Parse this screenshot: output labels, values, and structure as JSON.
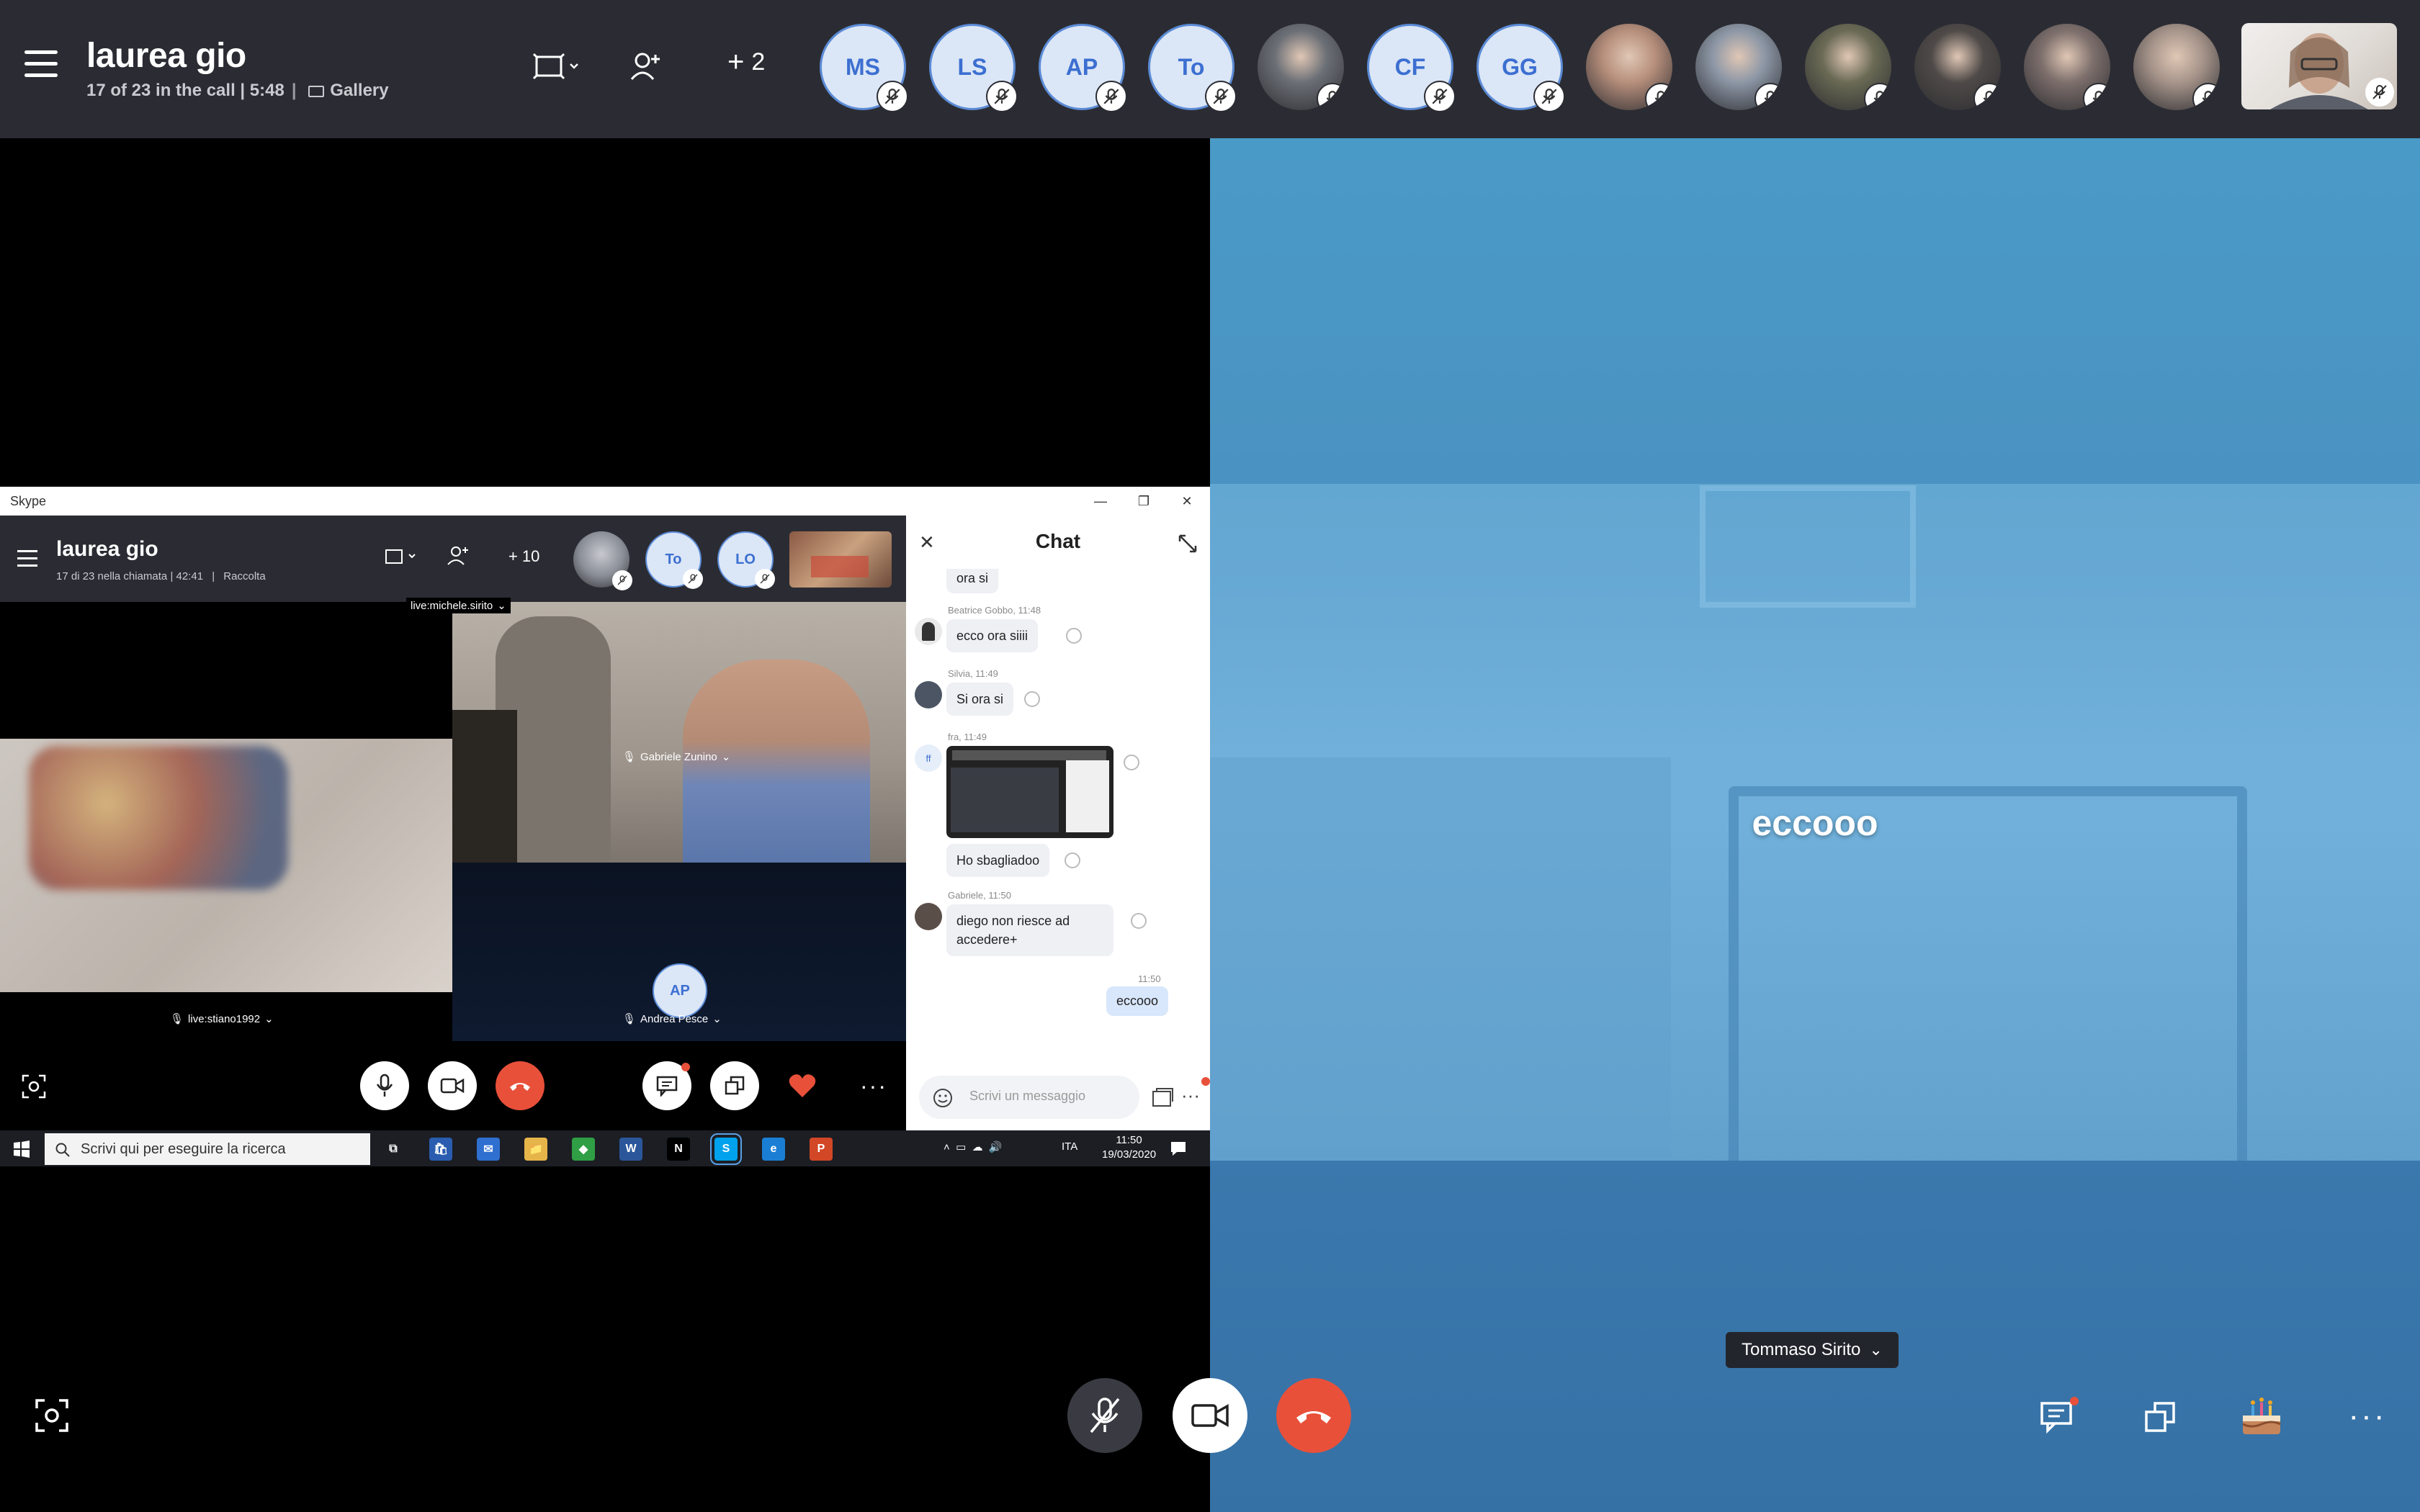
{
  "call": {
    "title": "laurea gio",
    "status": "17 of 23 in the call | 5:48",
    "sep": "|",
    "view": "Gallery",
    "more_count": "2",
    "participants": [
      {
        "kind": "initials",
        "initials": "MS"
      },
      {
        "kind": "initials",
        "initials": "LS"
      },
      {
        "kind": "initials",
        "initials": "AP"
      },
      {
        "kind": "initials",
        "initials": "To"
      },
      {
        "kind": "photo",
        "tone": "#6b6f76"
      },
      {
        "kind": "initials",
        "initials": "CF"
      },
      {
        "kind": "initials",
        "initials": "GG"
      },
      {
        "kind": "photo",
        "tone": "#b78f7c"
      },
      {
        "kind": "photo",
        "tone": "#8d97a6"
      },
      {
        "kind": "photo",
        "tone": "#6a6a55"
      },
      {
        "kind": "photo",
        "tone": "#4f4a48"
      },
      {
        "kind": "photo",
        "tone": "#7d6f6c"
      },
      {
        "kind": "photo",
        "tone": "#a7958b"
      }
    ]
  },
  "remote": {
    "caption": "eccooo",
    "name": "Tommaso Sirito"
  },
  "shared_screen": {
    "window_title": "Skype",
    "title": "laurea gio",
    "status": "17 di 23 nella chiamata | 42:41",
    "sep": "|",
    "view": "Raccolta",
    "more_count": "10",
    "participants": [
      {
        "kind": "photo",
        "tone": "#8a8e96"
      },
      {
        "kind": "initials",
        "initials": "To"
      },
      {
        "kind": "initials",
        "initials": "LO"
      },
      {
        "kind": "photo",
        "tone": "#9b6a55"
      }
    ],
    "tiles": {
      "top_label": "live:michele.sirito",
      "left_label": "live:stiano1992",
      "center_label": "Gabriele Zunino",
      "bottom_label": "Andrea Pesce",
      "bottom_initials": "AP"
    },
    "chat": {
      "title": "Chat",
      "messages": [
        {
          "sender": "",
          "text": "ora si"
        },
        {
          "sender": "Beatrice Gobbo, 11:48",
          "text": "ecco ora siiii"
        },
        {
          "sender": "Silvia, 11:49",
          "text": "Si ora si"
        },
        {
          "sender": "fra, 11:49",
          "text": "Ho sbagliadoo",
          "initials": "ff"
        },
        {
          "sender": "Gabriele, 11:50",
          "text": "diego non riesce ad accedere+"
        }
      ],
      "own_time": "11:50",
      "own_text": "eccooo",
      "input_placeholder": "Scrivi un messaggio"
    },
    "taskbar": {
      "search_placeholder": "Scrivi qui per eseguire la ricerca",
      "lang": "ITA",
      "time": "11:50",
      "date": "19/03/2020",
      "apps": [
        {
          "name": "task-view",
          "label": "⧉",
          "color": "#1c1e24"
        },
        {
          "name": "store",
          "label": "🛍",
          "color": "#2a5db0"
        },
        {
          "name": "mail",
          "label": "✉",
          "color": "#2f6fd0"
        },
        {
          "name": "explorer",
          "label": "📁",
          "color": "#e6b54a"
        },
        {
          "name": "green-app",
          "label": "◆",
          "color": "#2f9e44"
        },
        {
          "name": "word",
          "label": "W",
          "color": "#2b579a"
        },
        {
          "name": "netflix",
          "label": "N",
          "color": "#000000"
        },
        {
          "name": "skype",
          "label": "S",
          "color": "#00a2ed"
        },
        {
          "name": "edge",
          "label": "e",
          "color": "#1a7fd4"
        },
        {
          "name": "powerpoint",
          "label": "P",
          "color": "#d24726"
        }
      ]
    }
  },
  "colors": {
    "accent_red": "#e8503a",
    "bar_bg": "#2b2c33",
    "avatar_text": "#3c6fd1"
  }
}
